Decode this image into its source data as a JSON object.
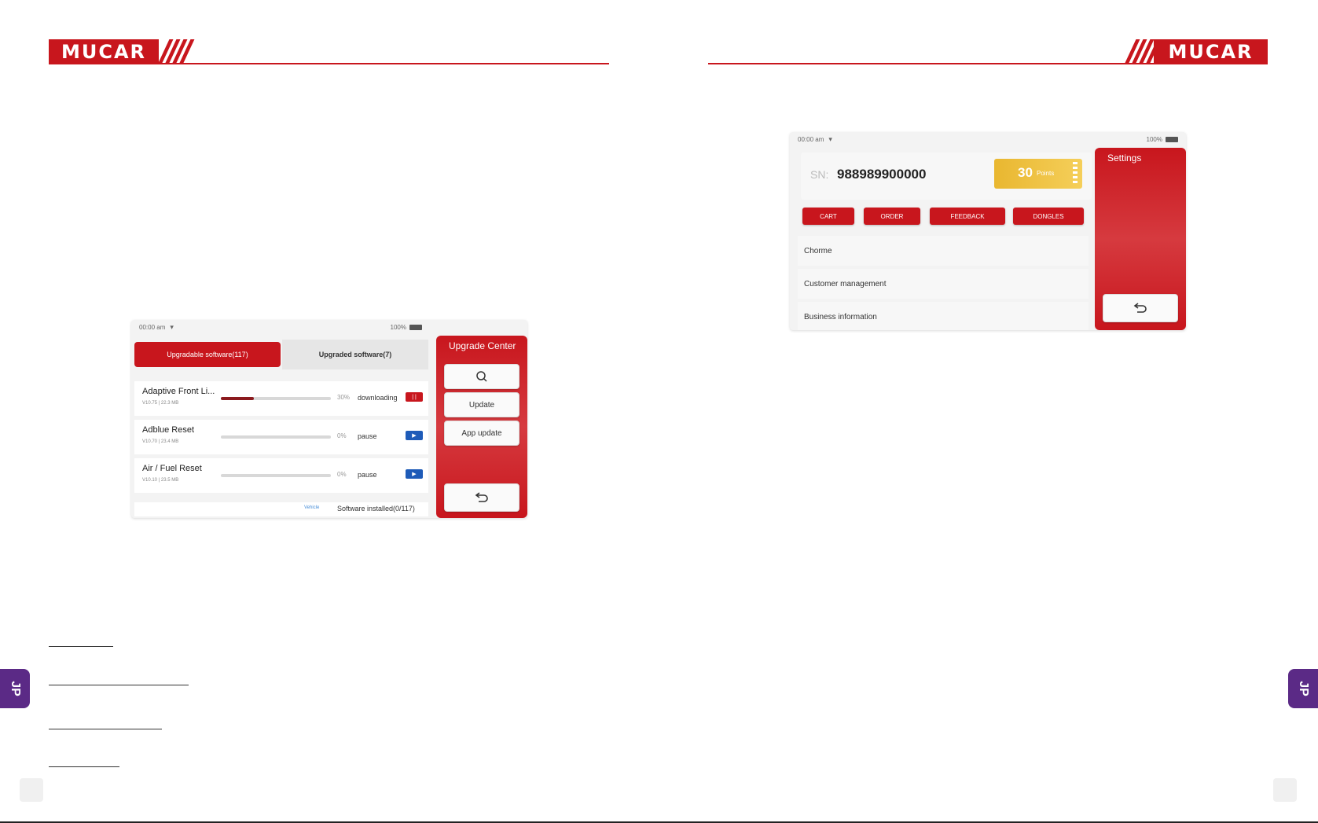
{
  "brand": {
    "logo_text": "MUCAR",
    "accent": "#c8161d"
  },
  "side_tab": {
    "label": "JP",
    "color": "#5b2a86"
  },
  "upgrade_screen": {
    "status_time": "00:00 am",
    "status_battery": "100%",
    "tab_upgradable": "Upgradable software(117)",
    "tab_upgraded": "Upgraded software(7)",
    "panel_title": "Upgrade Center",
    "btn_update": "Update",
    "btn_app_update": "App update",
    "items": [
      {
        "name": "Adaptive Front Li...",
        "meta": "V10.75 | 22.3 MB",
        "percent": "30%",
        "progress": 0.3,
        "state": "downloading",
        "action": "| |"
      },
      {
        "name": "Adblue Reset",
        "meta": "V10.70 | 23.4 MB",
        "percent": "0%",
        "progress": 0,
        "state": "pause",
        "action": "▶"
      },
      {
        "name": "Air / Fuel Reset",
        "meta": "V10.10 | 23.5 MB",
        "percent": "0%",
        "progress": 0,
        "state": "pause",
        "action": "▶"
      }
    ],
    "footer_link": "Vehicle",
    "footer_text": "Software installed(0/117)"
  },
  "settings_screen": {
    "status_time": "00:00 am",
    "status_battery": "100%",
    "sn_label": "SN:",
    "sn_value": "988989900000",
    "points_value": "30",
    "points_label": "Points",
    "buttons": [
      "CART",
      "ORDER",
      "FEEDBACK",
      "DONGLES"
    ],
    "rows": [
      "Chorme",
      "Customer management",
      "Business information"
    ],
    "panel_title": "Settings"
  }
}
